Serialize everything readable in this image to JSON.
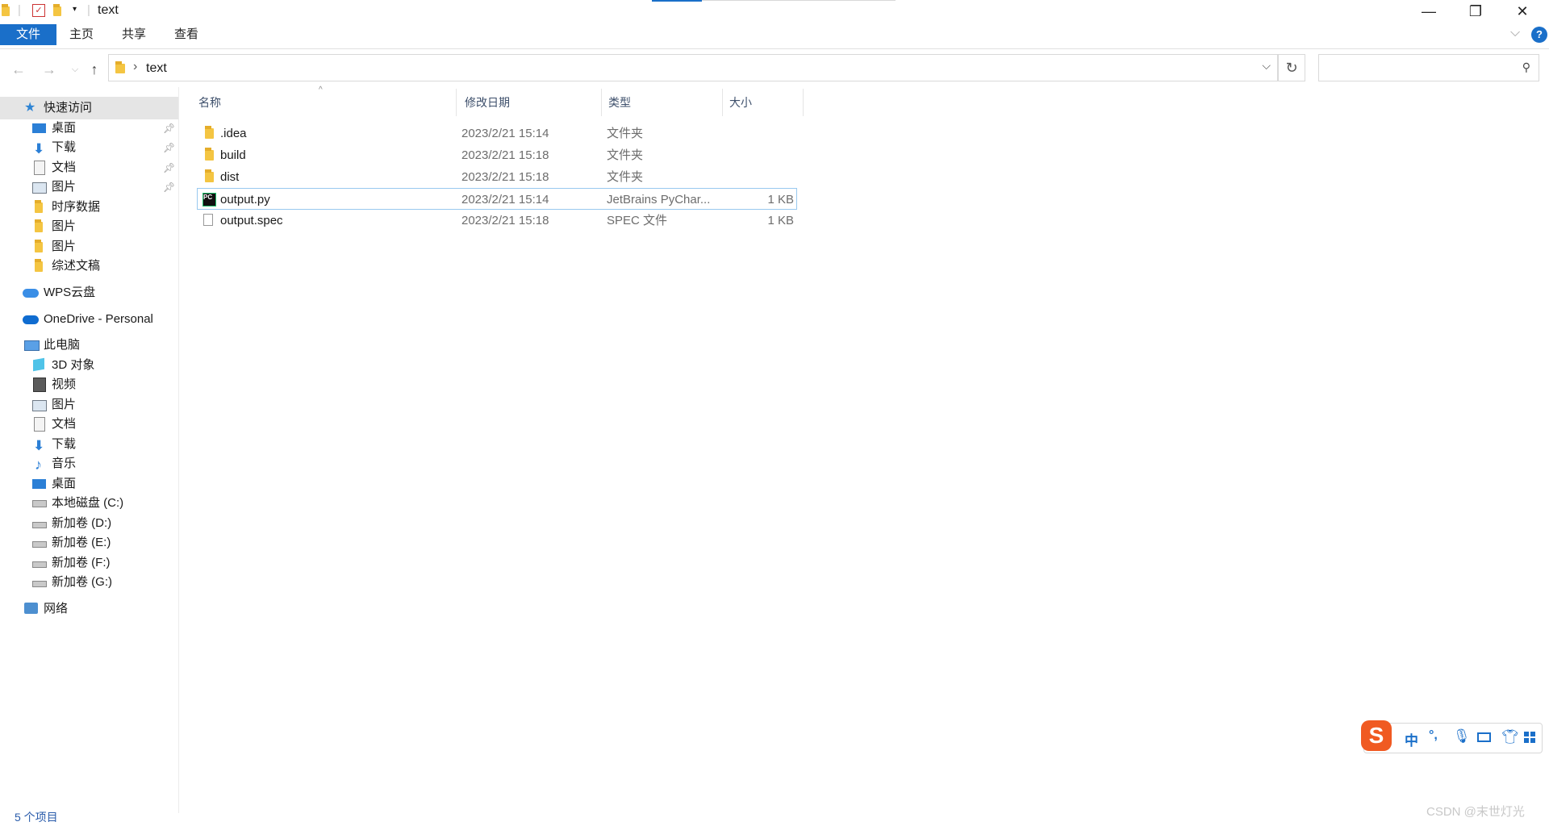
{
  "window": {
    "title": "text",
    "minimize_glyph": "—",
    "maximize_glyph": "❐",
    "close_glyph": "✕"
  },
  "ribbon": {
    "tabs": [
      "文件",
      "主页",
      "共享",
      "查看"
    ],
    "help_glyph": "?",
    "expand_glyph": "⌵"
  },
  "address": {
    "path": "text",
    "search_placeholder": ""
  },
  "sidebar": {
    "quick_access": "快速访问",
    "quick_items": [
      "桌面",
      "下载",
      "文档",
      "图片",
      "时序数据",
      "图片",
      "图片",
      "综述文稿"
    ],
    "wps": "WPS云盘",
    "onedrive": "OneDrive - Personal",
    "this_pc": "此电脑",
    "pc_items": [
      "3D 对象",
      "视频",
      "图片",
      "文档",
      "下载",
      "音乐",
      "桌面",
      "本地磁盘 (C:)",
      "新加卷 (D:)",
      "新加卷 (E:)",
      "新加卷 (F:)",
      "新加卷 (G:)"
    ],
    "network": "网络"
  },
  "columns": {
    "name": "名称",
    "date": "修改日期",
    "type": "类型",
    "size": "大小"
  },
  "files": [
    {
      "name": ".idea",
      "date": "2023/2/21 15:14",
      "type": "文件夹",
      "size": "",
      "icon": "folder-icon"
    },
    {
      "name": "build",
      "date": "2023/2/21 15:18",
      "type": "文件夹",
      "size": "",
      "icon": "folder-icon"
    },
    {
      "name": "dist",
      "date": "2023/2/21 15:18",
      "type": "文件夹",
      "size": "",
      "icon": "folder-icon"
    },
    {
      "name": "output.py",
      "date": "2023/2/21 15:14",
      "type": "JetBrains PyChar...",
      "size": "1 KB",
      "icon": "pycharm-file-icon"
    },
    {
      "name": "output.spec",
      "date": "2023/2/21 15:18",
      "type": "SPEC 文件",
      "size": "1 KB",
      "icon": "generic-file-icon"
    }
  ],
  "status": {
    "count": "5 个项目"
  },
  "ime": {
    "logo": "S",
    "mode": "中",
    "punct": "°,"
  },
  "watermark": "CSDN @末世灯光",
  "colors": {
    "file_tab": "#1a6fc9",
    "selection_border": "#99c9ef",
    "folder": "#f4c542",
    "ime_logo": "#f05a22"
  }
}
